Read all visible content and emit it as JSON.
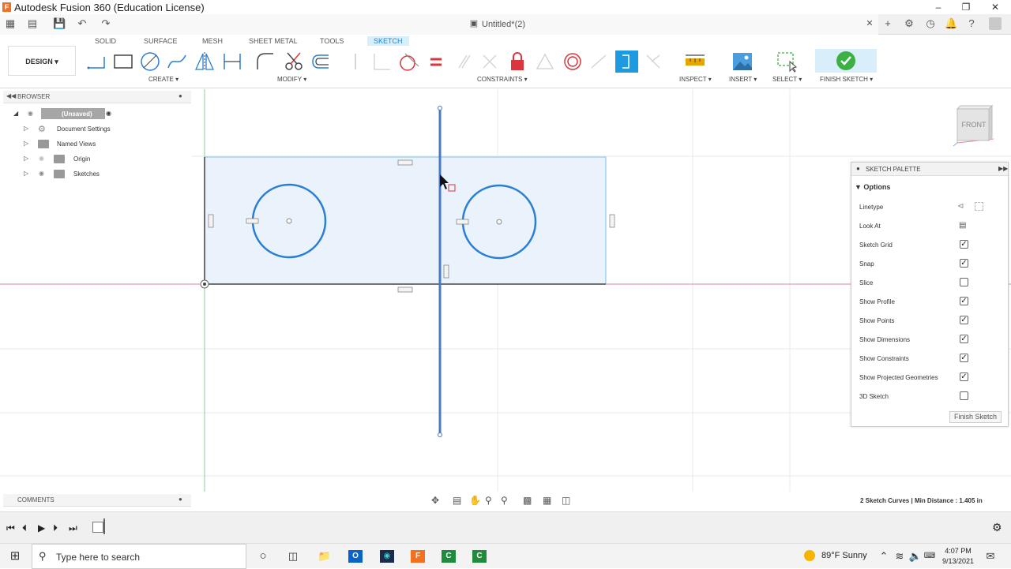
{
  "window": {
    "title": "Autodesk Fusion 360 (Education License)"
  },
  "document": {
    "title": "Untitled*(2)"
  },
  "ribbon": {
    "tabs": [
      "SOLID",
      "SURFACE",
      "MESH",
      "SHEET METAL",
      "TOOLS",
      "SKETCH"
    ],
    "active_tab": "SKETCH",
    "workspace": "DESIGN",
    "groups": {
      "create": "CREATE",
      "modify": "MODIFY",
      "constraints": "CONSTRAINTS",
      "inspect": "INSPECT",
      "insert": "INSERT",
      "select": "SELECT",
      "finish": "FINISH SKETCH"
    }
  },
  "browser": {
    "header": "BROWSER",
    "items": [
      "(Unsaved)",
      "Document Settings",
      "Named Views",
      "Origin",
      "Sketches"
    ]
  },
  "viewcube": {
    "label": "FRONT"
  },
  "palette": {
    "header": "SKETCH PALETTE",
    "section": "Options",
    "rows": [
      {
        "label": "Linetype",
        "control": "icons"
      },
      {
        "label": "Look At",
        "control": "icon"
      },
      {
        "label": "Sketch Grid",
        "checked": true
      },
      {
        "label": "Snap",
        "checked": true
      },
      {
        "label": "Slice",
        "checked": false
      },
      {
        "label": "Show Profile",
        "checked": true
      },
      {
        "label": "Show Points",
        "checked": true
      },
      {
        "label": "Show Dimensions",
        "checked": true
      },
      {
        "label": "Show Constraints",
        "checked": true
      },
      {
        "label": "Show Projected Geometries",
        "checked": true
      },
      {
        "label": "3D Sketch",
        "checked": false
      }
    ],
    "finish_button": "Finish Sketch"
  },
  "comments": {
    "header": "COMMENTS"
  },
  "status": {
    "text": "2 Sketch Curves | Min Distance : 1.405 in"
  },
  "taskbar": {
    "search_placeholder": "Type here to search",
    "weather": "89°F  Sunny",
    "time": "4:07 PM",
    "date": "9/13/2021"
  },
  "colors": {
    "sketch_blue": "#2a7fd4",
    "profile_fill": "#eaf3fb",
    "accent_tab": "#1e85d0",
    "finish_green": "#3cb043",
    "constraint_red": "#d9363e"
  }
}
